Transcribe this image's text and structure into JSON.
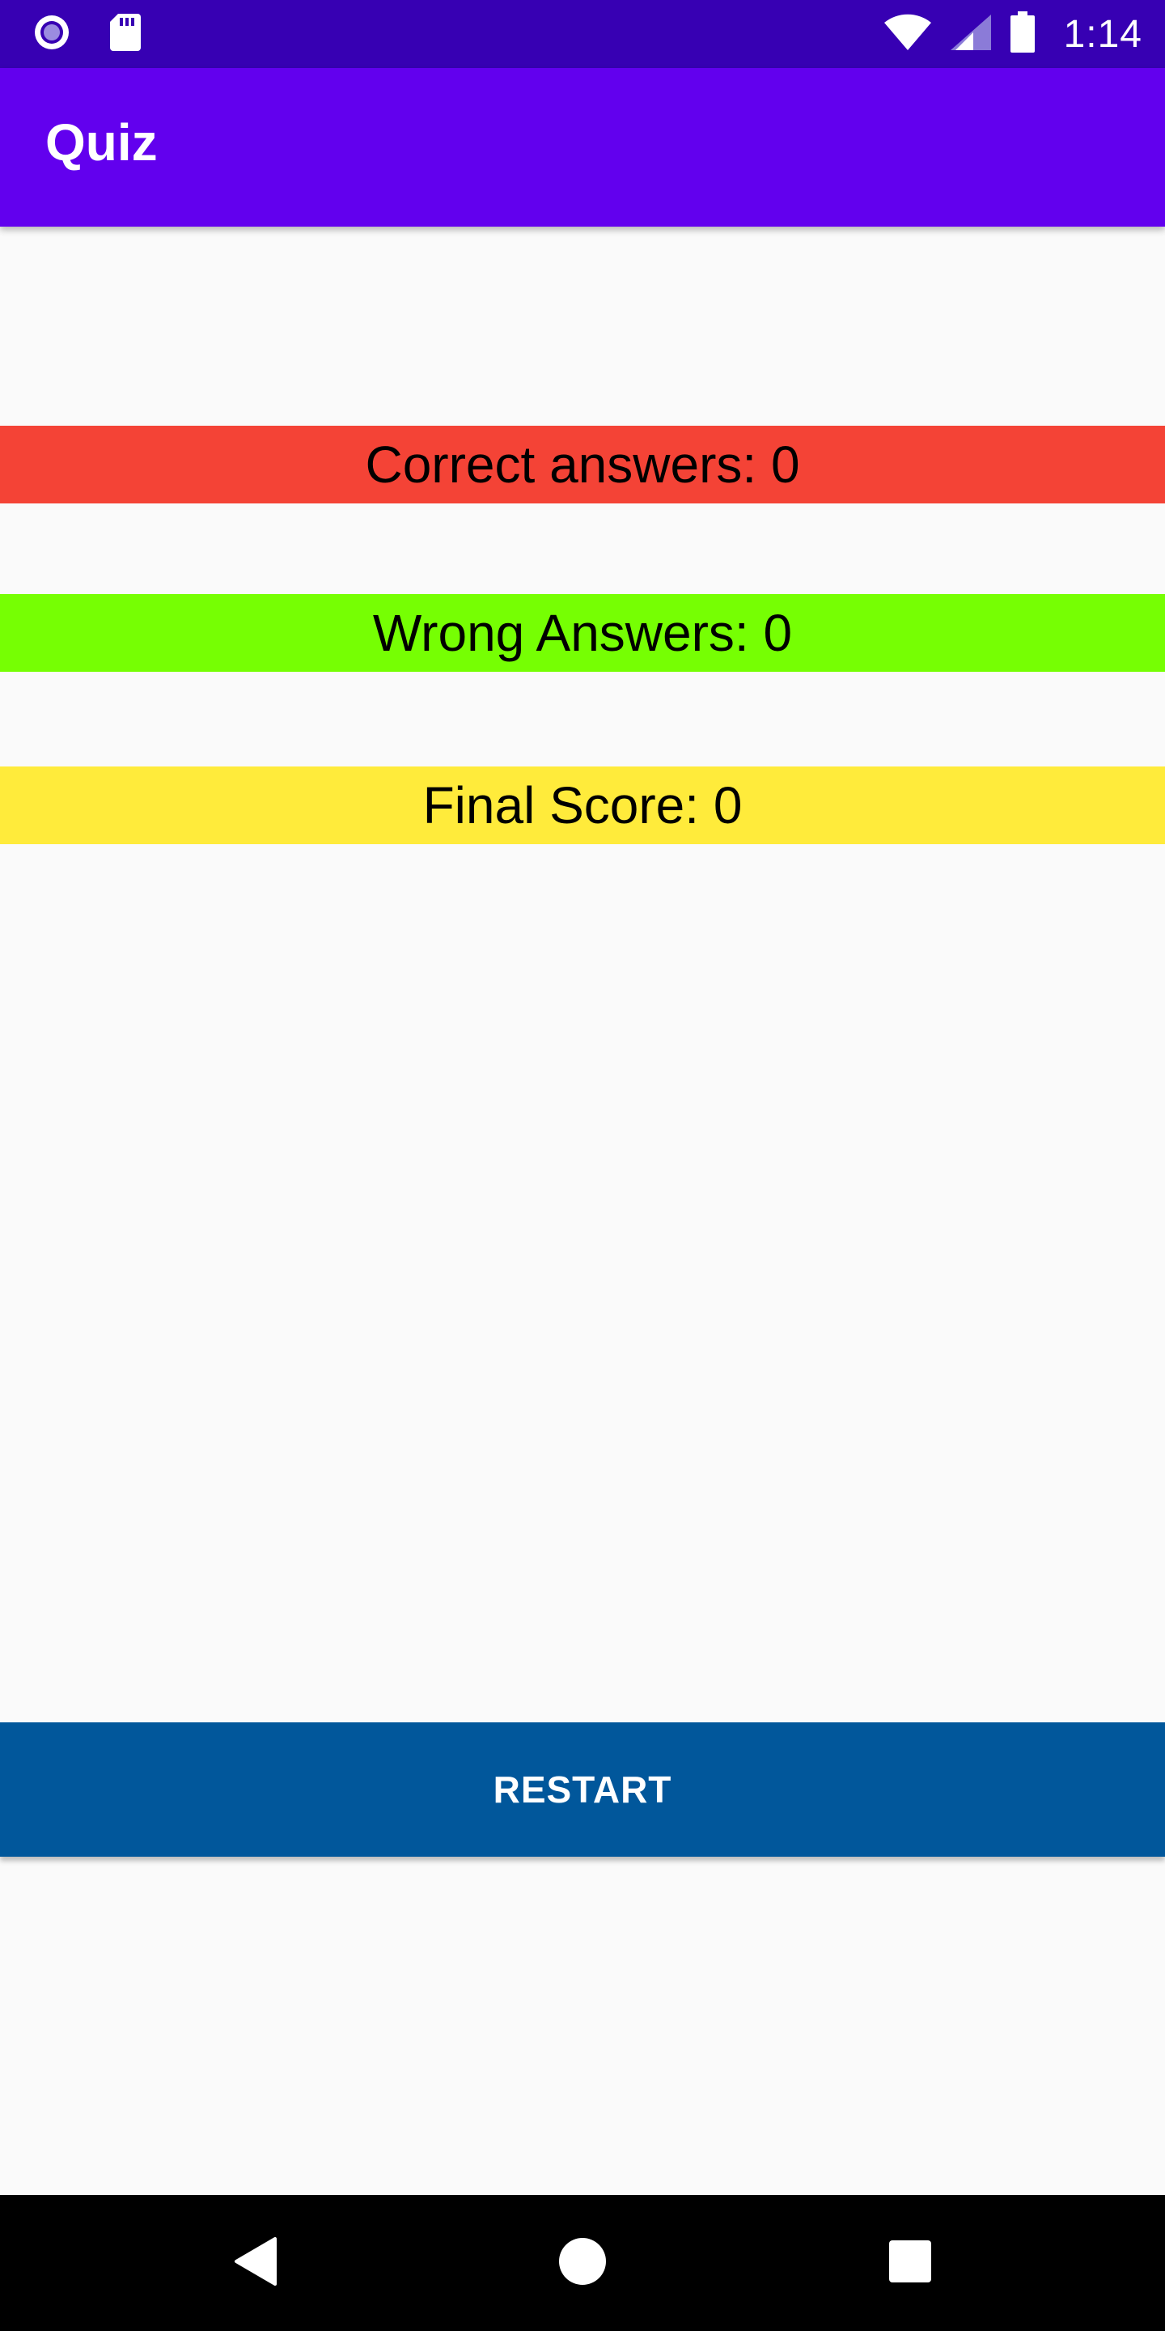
{
  "status_bar": {
    "time": "1:14",
    "icons": [
      "notification-circle-icon",
      "sd-card-icon",
      "wifi-icon",
      "signal-icon",
      "battery-icon"
    ]
  },
  "app_bar": {
    "title": "Quiz"
  },
  "results": {
    "correct_label": "Correct answers: 0",
    "wrong_label": "Wrong Answers: 0",
    "score_label": "Final Score: 0"
  },
  "restart_button": {
    "label": "RESTART"
  },
  "nav_bar": {
    "icons": [
      "back-icon",
      "home-icon",
      "recents-icon"
    ]
  },
  "colors": {
    "status_bar": "#3700b3",
    "app_bar": "#6200ee",
    "correct_bg": "#f44336",
    "wrong_bg": "#76ff03",
    "score_bg": "#ffeb3b",
    "restart_bg": "#01579b",
    "background": "#fafafa"
  }
}
